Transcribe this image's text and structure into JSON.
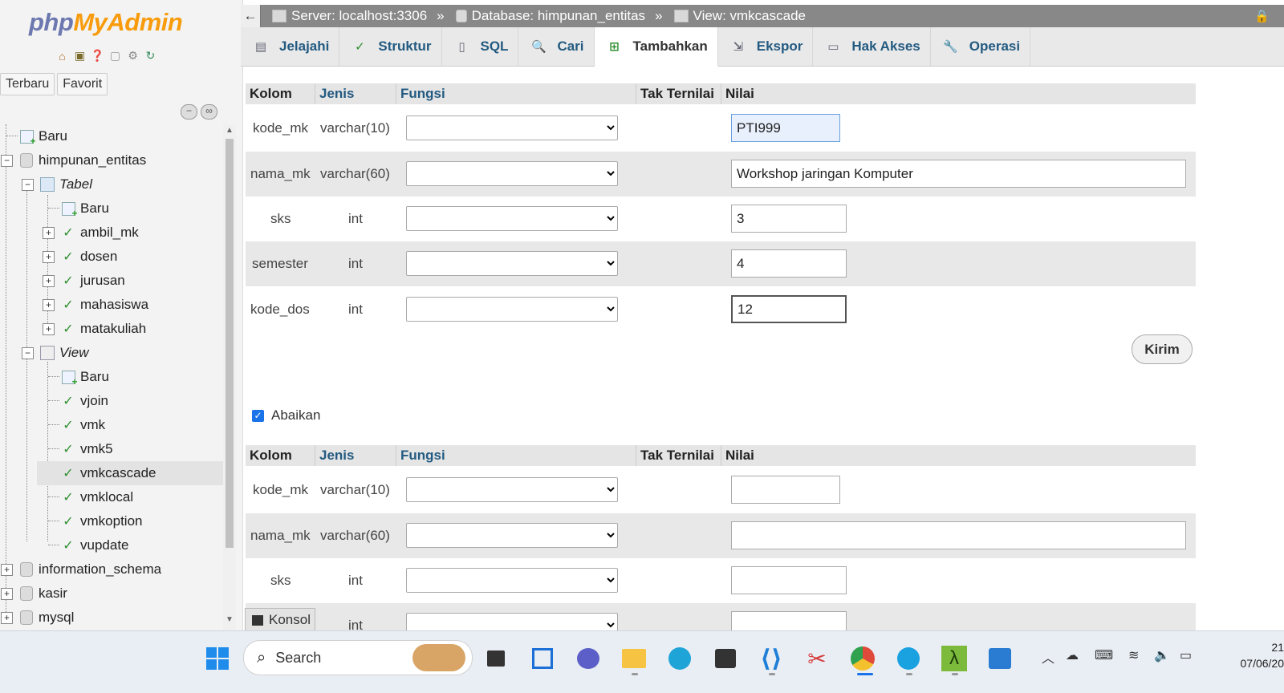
{
  "app": {
    "logo_php": "php",
    "logo_myadmin": "MyAdmin"
  },
  "sidebar": {
    "tabs": [
      "Terbaru",
      "Favorit"
    ],
    "quick_icons": [
      "home-icon",
      "logout-icon",
      "help-icon",
      "docs-icon",
      "settings-icon",
      "reload-icon"
    ],
    "tree": {
      "new": "Baru",
      "db_current": "himpunan_entitas",
      "tabel_group": "Tabel",
      "tabel_new": "Baru",
      "tables": [
        "ambil_mk",
        "dosen",
        "jurusan",
        "mahasiswa",
        "matakuliah"
      ],
      "view_group": "View",
      "view_new": "Baru",
      "views": [
        "vjoin",
        "vmk",
        "vmk5",
        "vmkcascade",
        "vmklocal",
        "vmkoption",
        "vupdate"
      ],
      "other_dbs": [
        "information_schema",
        "kasir",
        "mysql"
      ]
    }
  },
  "breadcrumb": {
    "server": "Server: localhost:3306",
    "database": "Database: himpunan_entitas",
    "view": "View: vmkcascade",
    "separator": "»"
  },
  "tabs": [
    {
      "label": "Jelajahi",
      "icon": "browse-icon"
    },
    {
      "label": "Struktur",
      "icon": "structure-icon"
    },
    {
      "label": "SQL",
      "icon": "sql-icon"
    },
    {
      "label": "Cari",
      "icon": "search-icon"
    },
    {
      "label": "Tambahkan",
      "icon": "insert-icon"
    },
    {
      "label": "Ekspor",
      "icon": "export-icon"
    },
    {
      "label": "Hak Akses",
      "icon": "privileges-icon"
    },
    {
      "label": "Operasi",
      "icon": "operations-icon"
    }
  ],
  "form_headers": {
    "kolom": "Kolom",
    "jenis": "Jenis",
    "fungsi": "Fungsi",
    "tak_ternilai": "Tak Ternilai",
    "nilai": "Nilai"
  },
  "form1": {
    "rows": [
      {
        "kolom": "kode_mk",
        "jenis": "varchar(10)",
        "value": "PTI999"
      },
      {
        "kolom": "nama_mk",
        "jenis": "varchar(60)",
        "value": "Workshop jaringan Komputer"
      },
      {
        "kolom": "sks",
        "jenis": "int",
        "value": "3"
      },
      {
        "kolom": "semester",
        "jenis": "int",
        "value": "4"
      },
      {
        "kolom": "kode_dos",
        "jenis": "int",
        "value": "12"
      }
    ]
  },
  "submit_label": "Kirim",
  "ignore_label": "Abaikan",
  "form2": {
    "rows": [
      {
        "kolom": "kode_mk",
        "jenis": "varchar(10)",
        "value": ""
      },
      {
        "kolom": "nama_mk",
        "jenis": "varchar(60)",
        "value": ""
      },
      {
        "kolom": "sks",
        "jenis": "int",
        "value": ""
      },
      {
        "kolom": "",
        "jenis": "int",
        "value": ""
      }
    ]
  },
  "console_label": "Konsol",
  "taskbar": {
    "search_label": "Search",
    "clock_time": "21",
    "clock_date": "07/06/20"
  }
}
